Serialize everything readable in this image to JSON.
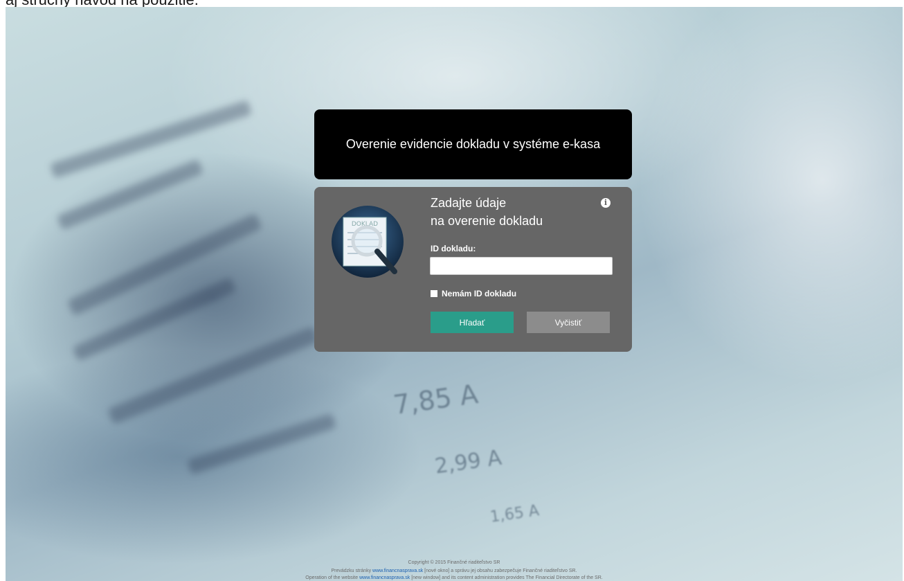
{
  "top_text": "aj stručný návod na použitie.",
  "background": {
    "receipt_amounts": [
      "7,85 A",
      "2,99 A",
      "1,65 A"
    ]
  },
  "title_box": {
    "title": "Overenie evidencie dokladu v systéme e-kasa"
  },
  "form": {
    "logo_icon": "receipt-magnifier-icon",
    "logo_text": "DOKLAD",
    "heading_line1": "Zadajte údaje",
    "heading_line2": "na overenie dokladu",
    "info_icon": "info-icon",
    "info_glyph": "i",
    "id_label": "ID dokladu:",
    "id_value": "",
    "no_id_label": "Nemám ID dokladu",
    "search_button": "Hľadať",
    "clear_button": "Vyčistiť"
  },
  "footer": {
    "copyright": "Copyright © 2015 Finančné riaditeľstvo SR",
    "line_sk_before": "Prevádzku stránky",
    "line_sk_link": "www.financnasprava.sk",
    "line_sk_after": "[nové okno] a správu jej obsahu zabezpečuje Finančné riaditeľstvo SR.",
    "line_en_before": "Operation of the website",
    "line_en_link": "www.financnasprava.sk",
    "line_en_after": "[new window] and its content administration provides The Financial Directorate of the SR."
  },
  "colors": {
    "title_bg": "#000000",
    "form_bg": "#666666",
    "search_button": "#2a9d8a",
    "clear_button": "#8c8c8c",
    "link": "#1a5fb0"
  }
}
